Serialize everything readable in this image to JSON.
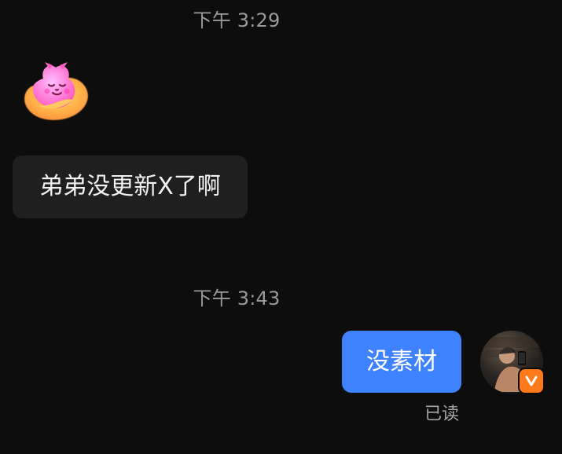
{
  "chat": {
    "timestamps": [
      "下午 3:29",
      "下午 3:43"
    ],
    "incoming": {
      "sticker_icon": "cat-hug-sticker-icon",
      "message": "弟弟没更新X了啊"
    },
    "outgoing": {
      "message": "没素材",
      "status": "已读",
      "avatar_icon": "user-avatar-icon",
      "badge_icon": "verified-v-badge-icon"
    },
    "colors": {
      "background": "#0d0d0d",
      "incoming_bubble": "#1f1f1f",
      "outgoing_bubble": "#3f82ff",
      "timestamp_text": "#9a9a9a",
      "badge": "#ff7a1a"
    }
  }
}
